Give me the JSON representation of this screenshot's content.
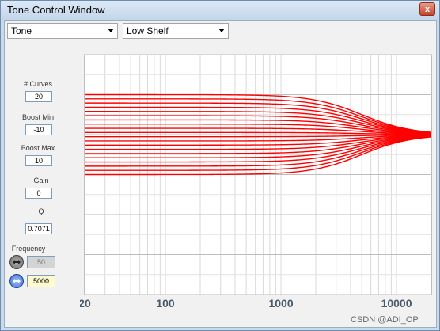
{
  "window": {
    "title": "Tone Control Window",
    "close_label": "x"
  },
  "toolbar": {
    "mode_select": "Tone",
    "filter_select": "Low Shelf"
  },
  "params": {
    "curves_label": "# Curves",
    "curves_value": "20",
    "boost_min_label": "Boost Min",
    "boost_min_value": "-10",
    "boost_max_label": "Boost Max",
    "boost_max_value": "10",
    "gain_label": "Gain",
    "gain_value": "0",
    "q_label": "Q",
    "q_value": "0.7071",
    "frequency_label": "Frequency",
    "freq_start_value": "50",
    "freq_end_value": "5000",
    "freq_start_icon": "arrows-icon",
    "freq_end_icon": "arrows-icon"
  },
  "colors": {
    "curve": "#ff0000",
    "accent": "#5b87d8"
  },
  "chart_data": {
    "type": "line",
    "x_scale": "log",
    "xlim": [
      20,
      20000
    ],
    "ylim": [
      -40,
      20
    ],
    "x_ticks": [
      "20",
      "100",
      "1000",
      "10000"
    ],
    "x_tick_values": [
      20,
      100,
      1000,
      10000
    ],
    "y_ticks": [
      "20",
      "10",
      "0",
      "-10",
      "-20",
      "-30",
      "-40"
    ],
    "y_tick_values": [
      20,
      10,
      0,
      -10,
      -20,
      -30,
      -40
    ],
    "grid": true,
    "curve_count": 20,
    "gain_min": -10,
    "gain_max": 10,
    "shelf_frequency": 5000,
    "series_description": "low shelf magnitude responses"
  },
  "watermark": "CSDN @ADI_OP"
}
